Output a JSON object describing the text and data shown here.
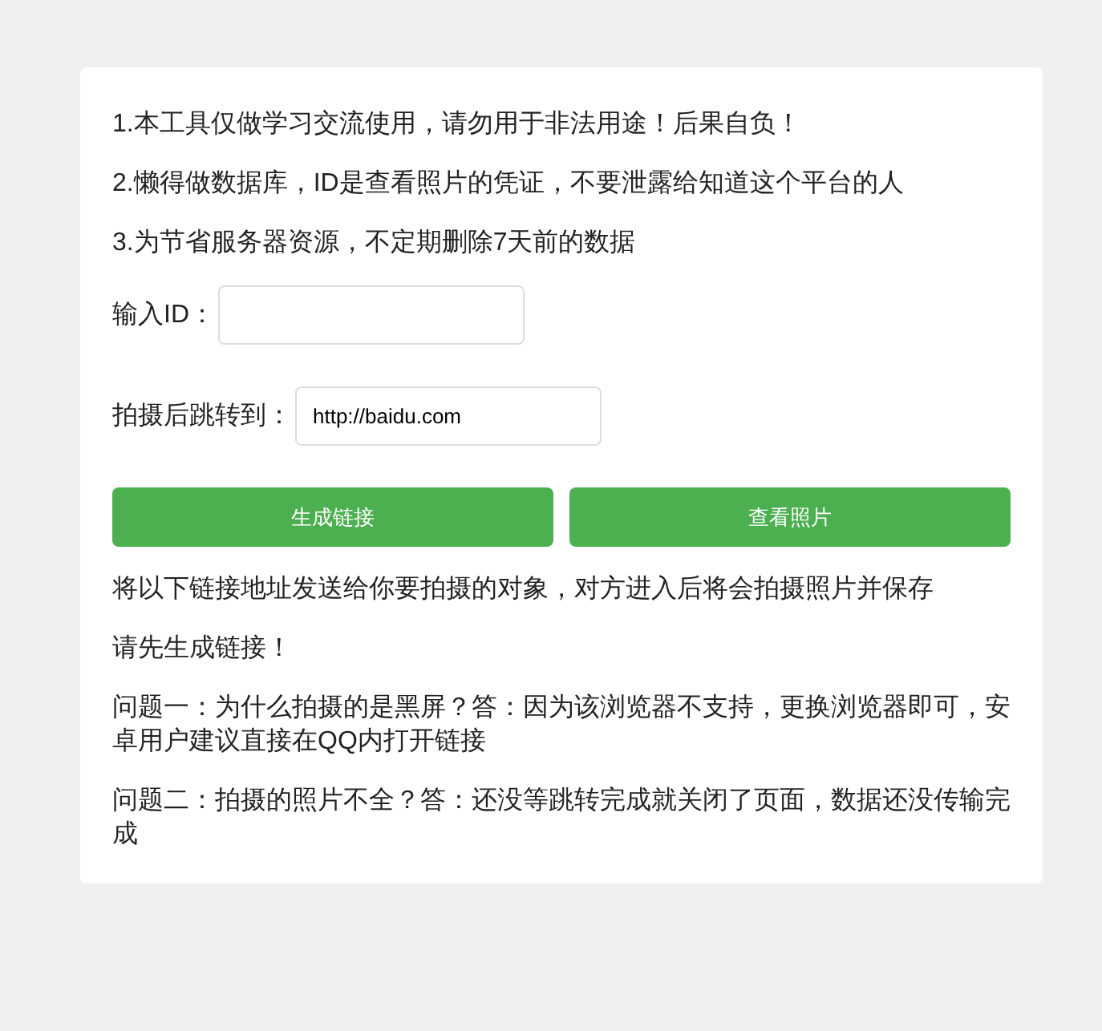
{
  "notices": [
    "1.本工具仅做学习交流使用，请勿用于非法用途！后果自负！",
    "2.懒得做数据库，ID是查看照片的凭证，不要泄露给知道这个平台的人",
    "3.为节省服务器资源，不定期删除7天前的数据"
  ],
  "fields": [
    {
      "label": "输入ID："
    },
    {
      "label": "拍摄后跳转到：",
      "value": "http://baidu.com"
    }
  ],
  "buttons": [
    "生成链接",
    "查看照片"
  ],
  "info": [
    "将以下链接地址发送给你要拍摄的对象，对方进入后将会拍摄照片并保存",
    "请先生成链接！",
    "问题一：为什么拍摄的是黑屏？答：因为该浏览器不支持，更换浏览器即可，安卓用户建议直接在QQ内打开链接",
    "问题二：拍摄的照片不全？答：还没等跳转完成就关闭了页面，数据还没传输完成"
  ]
}
